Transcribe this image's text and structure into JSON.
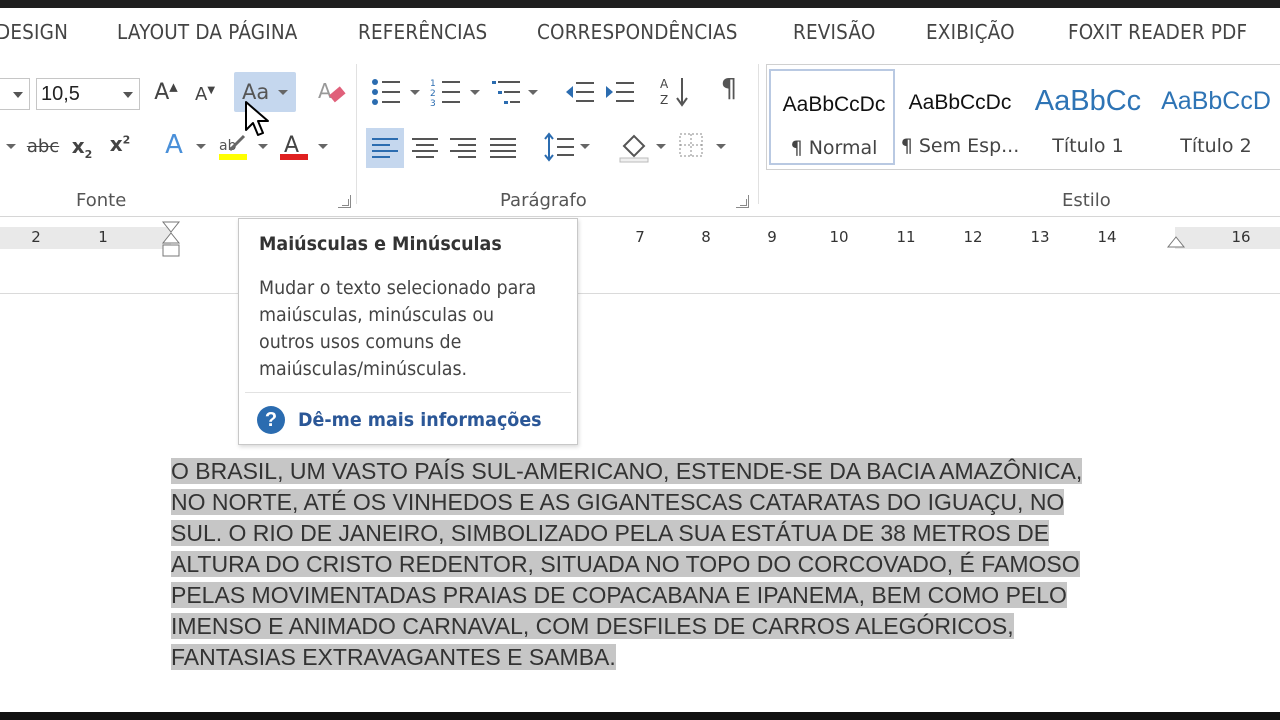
{
  "tabs": [
    "DESIGN",
    "LAYOUT DA PÁGINA",
    "REFERÊNCIAS",
    "CORRESPONDÊNCIAS",
    "REVISÃO",
    "EXIBIÇÃO",
    "FOXIT READER PDF"
  ],
  "font_group": {
    "font_size": "10,5",
    "change_case_label": "Aa",
    "label": "Fonte"
  },
  "paragraph_group": {
    "label": "Parágrafo"
  },
  "styles_group": {
    "label": "Estilo",
    "styles": [
      {
        "preview": "AaBbCcDc",
        "name": "¶ Normal"
      },
      {
        "preview": "AaBbCcDc",
        "name": "¶ Sem Esp..."
      },
      {
        "preview": "AaBbCc",
        "name": "Título 1"
      },
      {
        "preview": "AaBbCcD",
        "name": "Título 2"
      }
    ]
  },
  "ruler": {
    "numbers": [
      "2",
      "1",
      "7",
      "8",
      "9",
      "10",
      "11",
      "12",
      "13",
      "14",
      "16"
    ]
  },
  "tooltip": {
    "title": "Maiúsculas e Minúsculas",
    "body": "Mudar o texto selecionado para maiúsculas, minúsculas ou outros usos comuns de maiúsculas/minúsculas.",
    "link": "Dê-me mais informações",
    "help_symbol": "?"
  },
  "document": {
    "lines": [
      "O BRASIL, UM VASTO PAÍS SUL-AMERICANO, ESTENDE-SE DA BACIA AMAZÔNICA,",
      "NO NORTE, ATÉ OS VINHEDOS E AS GIGANTESCAS CATARATAS DO IGUAÇU, NO",
      "SUL. O RIO DE JANEIRO, SIMBOLIZADO PELA SUA ESTÁTUA DE 38 METROS DE",
      "ALTURA DO CRISTO REDENTOR, SITUADA NO TOPO DO CORCOVADO, É FAMOSO",
      "PELAS MOVIMENTADAS PRAIAS DE COPACABANA E IPANEMA, BEM COMO PELO",
      "IMENSO E ANIMADO CARNAVAL, COM DESFILES DE CARROS ALEGÓRICOS,",
      "FANTASIAS EXTRAVAGANTES E SAMBA."
    ]
  },
  "colors": {
    "highlight": "#c6c6c6",
    "accent_blue": "#2b6cb0",
    "font_color_red": "#e02020",
    "highlight_yellow": "#ffff00"
  }
}
